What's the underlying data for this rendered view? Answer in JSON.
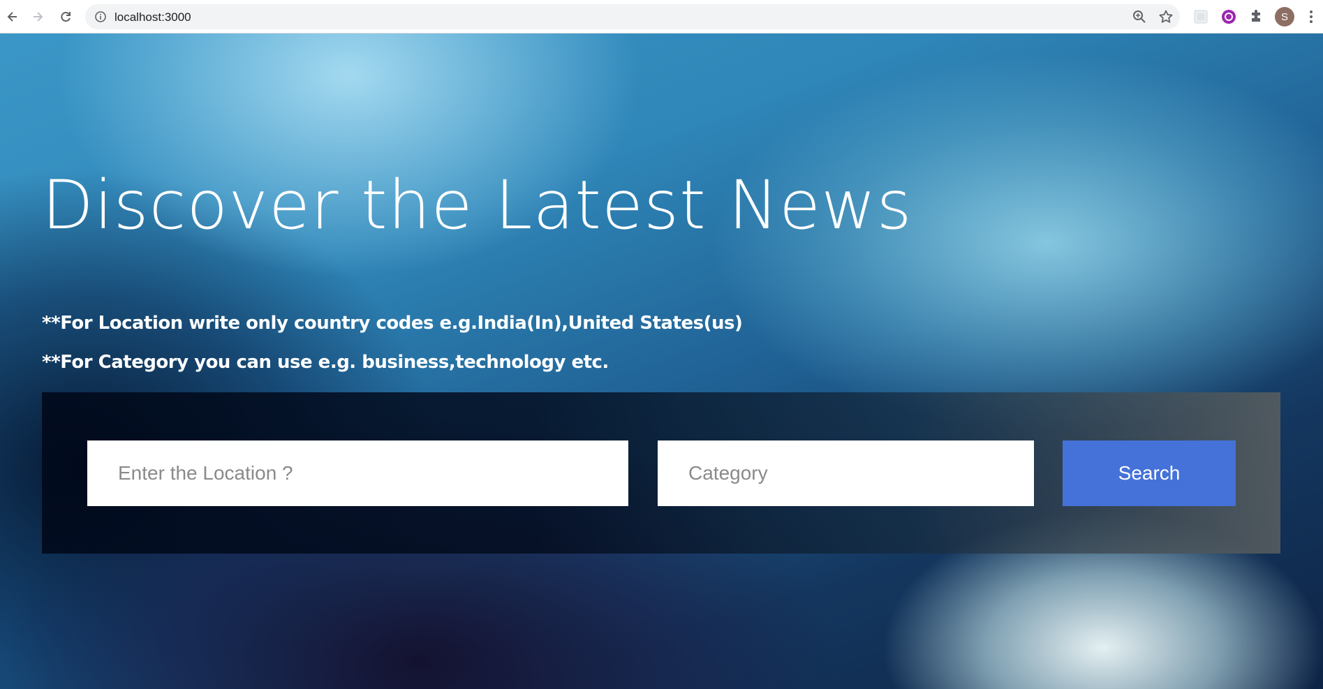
{
  "browser": {
    "url": "localhost:3000",
    "profile_initial": "S",
    "icons": {
      "back": "back-arrow-icon",
      "forward": "forward-arrow-icon",
      "reload": "reload-icon",
      "site_info": "info-icon",
      "zoom": "zoom-icon",
      "bookmark": "star-icon",
      "extension_1": "extension-square-icon",
      "extension_2": "extension-purple-icon",
      "extensions": "puzzle-icon",
      "menu": "kebab-menu-icon"
    }
  },
  "hero": {
    "title": "Discover the Latest News",
    "note_location": "**For Location write only country codes e.g.India(In),United States(us)",
    "note_category": "**For Category you can use e.g. business,technology etc."
  },
  "search": {
    "location_placeholder": "Enter the Location ?",
    "category_placeholder": "Category",
    "button_label": "Search"
  },
  "colors": {
    "button": "#4472d8",
    "text": "#ffffff"
  }
}
